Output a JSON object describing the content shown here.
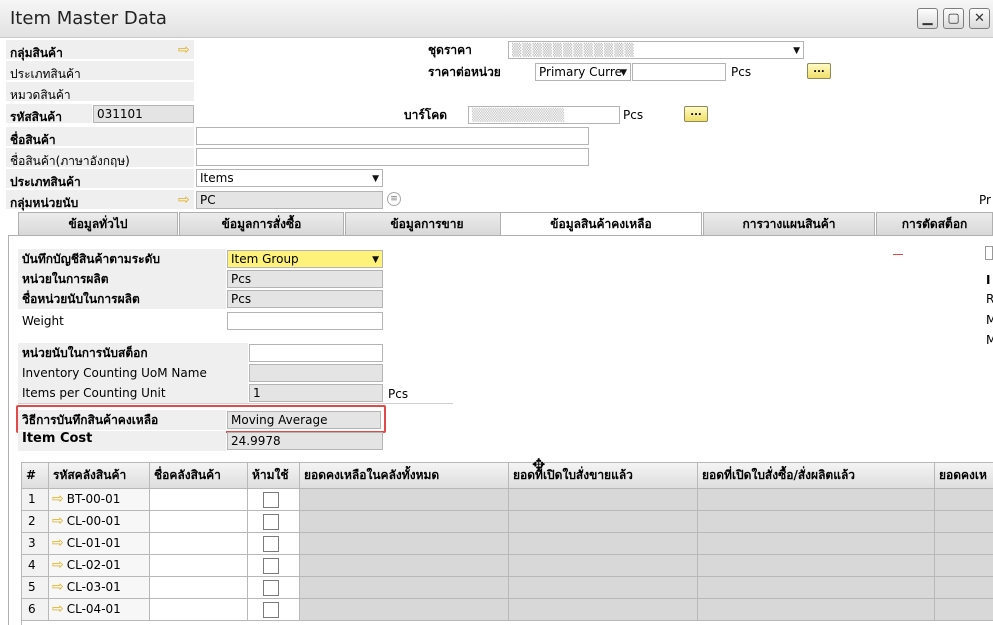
{
  "window": {
    "title": "Item Master Data"
  },
  "header": {
    "item_group_label": "กลุ่มสินค้า",
    "item_type_label": "ประเภทสินค้า",
    "item_category_label": "หมวดสินค้า",
    "item_code_label": "รหัสสินค้า",
    "item_code_value": "031101",
    "item_name_label": "ชื่อสินค้า",
    "item_name_en_label": "ชื่อสินค้า(ภาษาอังกฤษ)",
    "item_kind_label": "ประเภทสินค้า",
    "item_kind_value": "Items",
    "uom_group_label": "กลุ่มหน่วยนับ",
    "uom_group_value": "PC",
    "price_list_label": "ชุดราคา",
    "unit_price_label": "ราคาต่อหน่วย",
    "currency_value": "Primary Curre",
    "price_unit": "Pcs",
    "barcode_label": "บาร์โคด",
    "barcode_unit": "Pcs",
    "ellipsis": "...",
    "right_edge_label": "Pr"
  },
  "tabs": [
    {
      "label": "ข้อมูลทั่วไป"
    },
    {
      "label": "ข้อมูลการสั่งซื้อ"
    },
    {
      "label": "ข้อมูลการขาย"
    },
    {
      "label": "ข้อมูลสินค้าคงเหลือ"
    },
    {
      "label": "การวางแผนสินค้า"
    },
    {
      "label": "การตัดสต็อก"
    }
  ],
  "inventory": {
    "gl_method_label": "บันทึกบัญชีสินค้าตามระดับ",
    "gl_method_value": "Item Group",
    "prod_unit_label": "หน่วยในการผลิต",
    "prod_unit_value": "Pcs",
    "prod_unit_name_label": "ชื่อหน่วยนับในการผลิต",
    "prod_unit_name_value": "Pcs",
    "weight_label": "Weight",
    "counting_unit_label": "หน่วยนับในการนับสต็อก",
    "counting_uom_name_label": "Inventory Counting UoM Name",
    "items_per_counting_label": "Items per Counting Unit",
    "items_per_counting_value": "1",
    "items_per_counting_unit": "Pcs",
    "valuation_label": "วิธีการบันทึกสินค้าคงเหลือ",
    "valuation_value": "Moving Average",
    "item_cost_label": "Item Cost",
    "item_cost_value": "24.9978",
    "right_letters": [
      "I",
      "R",
      "M",
      "M"
    ]
  },
  "grid": {
    "headers": [
      "#",
      "รหัสคลังสินค้า",
      "ชื่อคลังสินค้า",
      "ห้ามใช้",
      "ยอดคงเหลือในคลังทั้งหมด",
      "ยอดที่เปิดใบสั่งขายแล้ว",
      "ยอดที่เปิดใบสั่งซื้อ/สั่งผลิตแล้ว",
      "ยอดคงเห"
    ],
    "rows": [
      {
        "num": "1",
        "code": "BT-00-01"
      },
      {
        "num": "2",
        "code": "CL-00-01"
      },
      {
        "num": "3",
        "code": "CL-01-01"
      },
      {
        "num": "4",
        "code": "CL-02-01"
      },
      {
        "num": "5",
        "code": "CL-03-01"
      },
      {
        "num": "6",
        "code": "CL-04-01"
      }
    ]
  },
  "colors": {
    "highlight_border": "#e24a4a",
    "yellow_field": "#fff27a"
  }
}
